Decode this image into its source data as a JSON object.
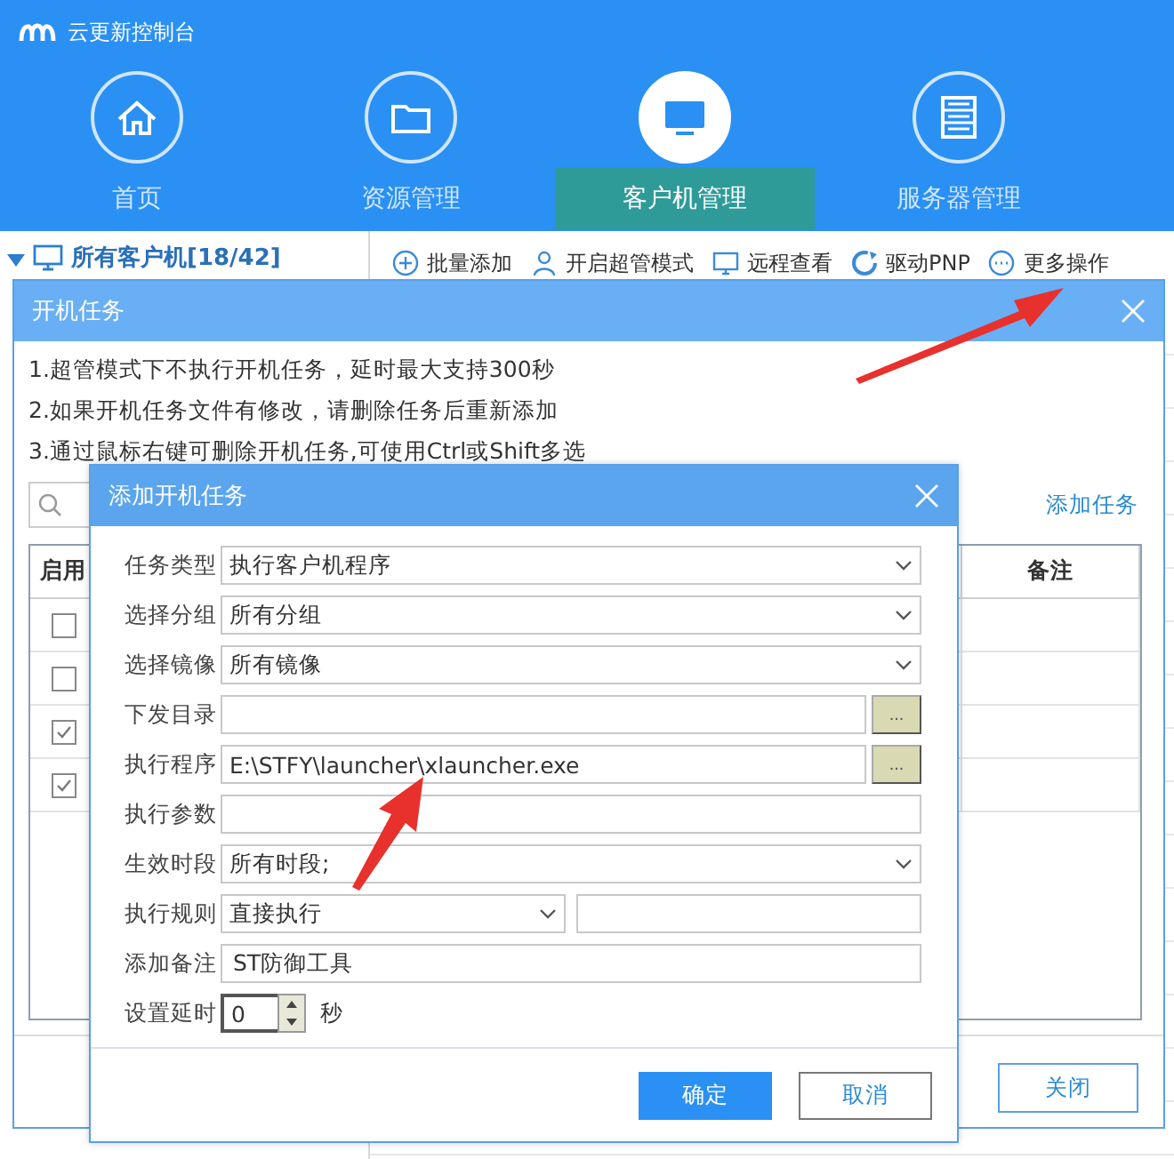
{
  "window": {
    "title": "云更新控制台"
  },
  "nav_tabs": [
    {
      "label": "首页",
      "selected": false,
      "kind": "home"
    },
    {
      "label": "资源管理",
      "selected": false,
      "kind": "folder"
    },
    {
      "label": "客户机管理",
      "selected": true,
      "kind": "monitor"
    },
    {
      "label": "服务器管理",
      "selected": false,
      "kind": "server"
    }
  ],
  "sidebar": {
    "label": "所有客户机[18/42]",
    "expanded": true
  },
  "toolbar": [
    {
      "label": "批量添加",
      "kind": "add"
    },
    {
      "label": "开启超管模式",
      "kind": "user"
    },
    {
      "label": "远程查看",
      "kind": "remote"
    },
    {
      "label": "驱动PNP",
      "kind": "driver"
    },
    {
      "label": "更多操作",
      "kind": "more"
    }
  ],
  "startup_dialog": {
    "title": "开机任务",
    "notes": [
      "1.超管模式下不执行开机任务，延时最大支持300秒",
      "2.如果开机任务文件有修改，请删除任务后重新添加",
      "3.通过鼠标右键可删除开机任务,可使用Ctrl或Shift多选"
    ],
    "add_link": "添加任务",
    "columns": [
      "启用",
      "备注"
    ],
    "rows": [
      {
        "checked": false
      },
      {
        "checked": false
      },
      {
        "checked": true
      },
      {
        "checked": true
      }
    ],
    "close_button": "关闭"
  },
  "add_dialog": {
    "title": "添加开机任务",
    "fields": [
      {
        "label": "任务类型",
        "kind": "select",
        "value": "执行客户机程序"
      },
      {
        "label": "选择分组",
        "kind": "select",
        "value": "所有分组"
      },
      {
        "label": "选择镜像",
        "kind": "select",
        "value": "所有镜像"
      },
      {
        "label": "下发目录",
        "kind": "browse",
        "browse_button": "..."
      },
      {
        "label": "执行程序",
        "kind": "browse",
        "value": "E:\\STFY\\launcher\\xlauncher.exe",
        "browse_button": "..."
      },
      {
        "label": "执行参数",
        "kind": "text"
      },
      {
        "label": "生效时段",
        "kind": "select",
        "value": "所有时段;"
      },
      {
        "label": "执行规则",
        "kind": "rule",
        "value": "直接执行"
      },
      {
        "label": "添加备注",
        "kind": "text",
        "value": "ST防御工具"
      },
      {
        "label": "设置延时",
        "kind": "spin",
        "value": "0",
        "unit": "秒"
      }
    ],
    "buttons": [
      {
        "label": "确定",
        "kind": "primary"
      },
      {
        "label": "取消",
        "kind": "secondary"
      }
    ]
  }
}
